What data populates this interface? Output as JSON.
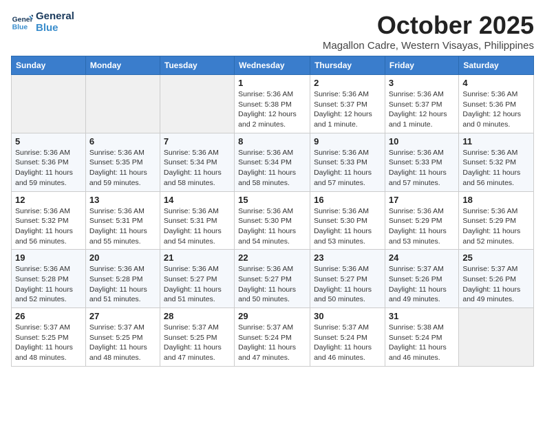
{
  "logo": {
    "line1": "General",
    "line2": "Blue"
  },
  "title": "October 2025",
  "location": "Magallon Cadre, Western Visayas, Philippines",
  "days_of_week": [
    "Sunday",
    "Monday",
    "Tuesday",
    "Wednesday",
    "Thursday",
    "Friday",
    "Saturday"
  ],
  "weeks": [
    [
      {
        "day": "",
        "info": ""
      },
      {
        "day": "",
        "info": ""
      },
      {
        "day": "",
        "info": ""
      },
      {
        "day": "1",
        "info": "Sunrise: 5:36 AM\nSunset: 5:38 PM\nDaylight: 12 hours\nand 2 minutes."
      },
      {
        "day": "2",
        "info": "Sunrise: 5:36 AM\nSunset: 5:37 PM\nDaylight: 12 hours\nand 1 minute."
      },
      {
        "day": "3",
        "info": "Sunrise: 5:36 AM\nSunset: 5:37 PM\nDaylight: 12 hours\nand 1 minute."
      },
      {
        "day": "4",
        "info": "Sunrise: 5:36 AM\nSunset: 5:36 PM\nDaylight: 12 hours\nand 0 minutes."
      }
    ],
    [
      {
        "day": "5",
        "info": "Sunrise: 5:36 AM\nSunset: 5:36 PM\nDaylight: 11 hours\nand 59 minutes."
      },
      {
        "day": "6",
        "info": "Sunrise: 5:36 AM\nSunset: 5:35 PM\nDaylight: 11 hours\nand 59 minutes."
      },
      {
        "day": "7",
        "info": "Sunrise: 5:36 AM\nSunset: 5:34 PM\nDaylight: 11 hours\nand 58 minutes."
      },
      {
        "day": "8",
        "info": "Sunrise: 5:36 AM\nSunset: 5:34 PM\nDaylight: 11 hours\nand 58 minutes."
      },
      {
        "day": "9",
        "info": "Sunrise: 5:36 AM\nSunset: 5:33 PM\nDaylight: 11 hours\nand 57 minutes."
      },
      {
        "day": "10",
        "info": "Sunrise: 5:36 AM\nSunset: 5:33 PM\nDaylight: 11 hours\nand 57 minutes."
      },
      {
        "day": "11",
        "info": "Sunrise: 5:36 AM\nSunset: 5:32 PM\nDaylight: 11 hours\nand 56 minutes."
      }
    ],
    [
      {
        "day": "12",
        "info": "Sunrise: 5:36 AM\nSunset: 5:32 PM\nDaylight: 11 hours\nand 56 minutes."
      },
      {
        "day": "13",
        "info": "Sunrise: 5:36 AM\nSunset: 5:31 PM\nDaylight: 11 hours\nand 55 minutes."
      },
      {
        "day": "14",
        "info": "Sunrise: 5:36 AM\nSunset: 5:31 PM\nDaylight: 11 hours\nand 54 minutes."
      },
      {
        "day": "15",
        "info": "Sunrise: 5:36 AM\nSunset: 5:30 PM\nDaylight: 11 hours\nand 54 minutes."
      },
      {
        "day": "16",
        "info": "Sunrise: 5:36 AM\nSunset: 5:30 PM\nDaylight: 11 hours\nand 53 minutes."
      },
      {
        "day": "17",
        "info": "Sunrise: 5:36 AM\nSunset: 5:29 PM\nDaylight: 11 hours\nand 53 minutes."
      },
      {
        "day": "18",
        "info": "Sunrise: 5:36 AM\nSunset: 5:29 PM\nDaylight: 11 hours\nand 52 minutes."
      }
    ],
    [
      {
        "day": "19",
        "info": "Sunrise: 5:36 AM\nSunset: 5:28 PM\nDaylight: 11 hours\nand 52 minutes."
      },
      {
        "day": "20",
        "info": "Sunrise: 5:36 AM\nSunset: 5:28 PM\nDaylight: 11 hours\nand 51 minutes."
      },
      {
        "day": "21",
        "info": "Sunrise: 5:36 AM\nSunset: 5:27 PM\nDaylight: 11 hours\nand 51 minutes."
      },
      {
        "day": "22",
        "info": "Sunrise: 5:36 AM\nSunset: 5:27 PM\nDaylight: 11 hours\nand 50 minutes."
      },
      {
        "day": "23",
        "info": "Sunrise: 5:36 AM\nSunset: 5:27 PM\nDaylight: 11 hours\nand 50 minutes."
      },
      {
        "day": "24",
        "info": "Sunrise: 5:37 AM\nSunset: 5:26 PM\nDaylight: 11 hours\nand 49 minutes."
      },
      {
        "day": "25",
        "info": "Sunrise: 5:37 AM\nSunset: 5:26 PM\nDaylight: 11 hours\nand 49 minutes."
      }
    ],
    [
      {
        "day": "26",
        "info": "Sunrise: 5:37 AM\nSunset: 5:25 PM\nDaylight: 11 hours\nand 48 minutes."
      },
      {
        "day": "27",
        "info": "Sunrise: 5:37 AM\nSunset: 5:25 PM\nDaylight: 11 hours\nand 48 minutes."
      },
      {
        "day": "28",
        "info": "Sunrise: 5:37 AM\nSunset: 5:25 PM\nDaylight: 11 hours\nand 47 minutes."
      },
      {
        "day": "29",
        "info": "Sunrise: 5:37 AM\nSunset: 5:24 PM\nDaylight: 11 hours\nand 47 minutes."
      },
      {
        "day": "30",
        "info": "Sunrise: 5:37 AM\nSunset: 5:24 PM\nDaylight: 11 hours\nand 46 minutes."
      },
      {
        "day": "31",
        "info": "Sunrise: 5:38 AM\nSunset: 5:24 PM\nDaylight: 11 hours\nand 46 minutes."
      },
      {
        "day": "",
        "info": ""
      }
    ]
  ]
}
